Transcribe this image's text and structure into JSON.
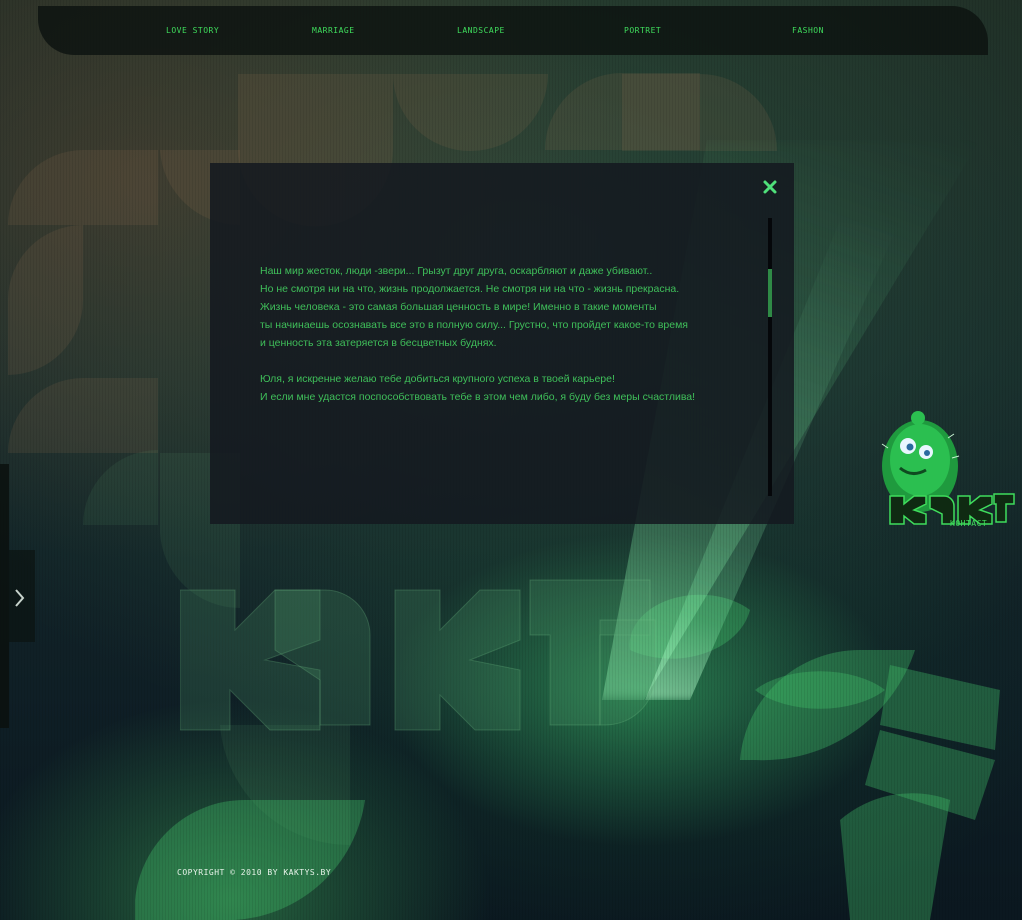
{
  "nav": {
    "items": [
      {
        "label": "LOVE STORY"
      },
      {
        "label": "MARRIAGE"
      },
      {
        "label": "LANDSCAPE"
      },
      {
        "label": "PORTRET"
      },
      {
        "label": "FASHON"
      }
    ]
  },
  "panel": {
    "close_icon": "close-icon",
    "paragraph1": [
      "Наш мир жесток, люди -звери... Грызут друг друга, оскарбляют и даже убивают..",
      "Но не смотря ни на что, жизнь продолжается. Не смотря ни на что - жизнь прекрасна.",
      "Жизнь человека - это самая большая ценность в мире! Именно в такие моменты",
      "ты начинаешь осознавать все это в полную силу... Грустно, что пройдет какое-то время",
      "и ценность эта затеряется в бесцветных буднях."
    ],
    "paragraph2": [
      "Юля, я искренне желаю тебе добиться крупного успеха в твоей карьере!",
      "И если мне удастся поспособствовать тебе в этом чем либо, я буду без меры счастлива!"
    ],
    "scroll_position": 0.22
  },
  "side": {
    "arrow_icon": "chevron-right-icon"
  },
  "logo": {
    "text": "KAKTYS",
    "contact_label": "KOHTACT"
  },
  "footer": {
    "copyright": "COPYRIGHT © 2010 BY KAKTYS.BY"
  },
  "colors": {
    "accent": "#3fdc5c",
    "text": "#3fbf5a",
    "panel": "#14181f"
  }
}
